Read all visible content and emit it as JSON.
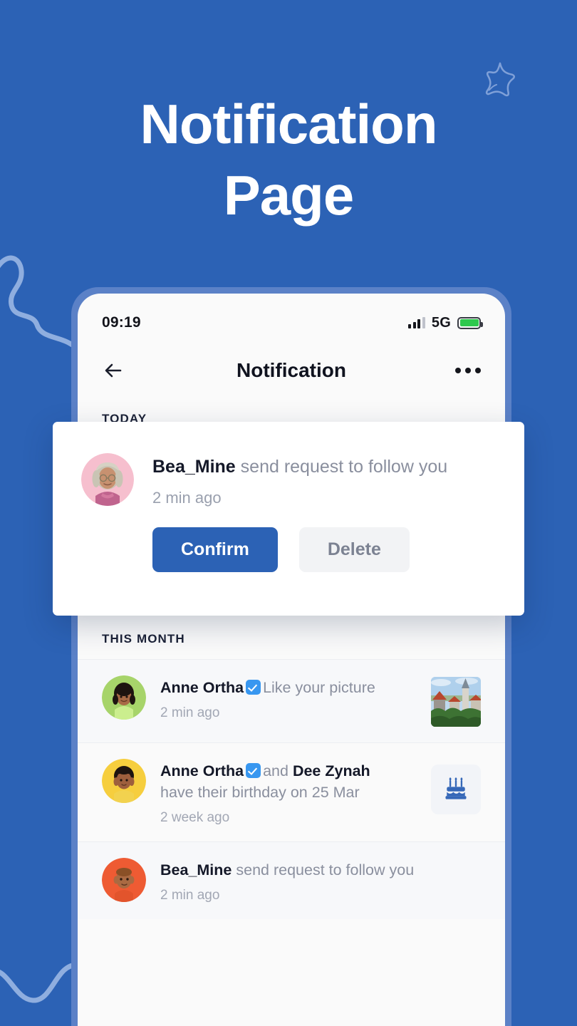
{
  "theme": {
    "background": "#2C62B5",
    "phone_frame": "#5B81C7",
    "screen": "#FAFAFA",
    "accent": "#2C62B5",
    "verified_badge": "#3897F0",
    "battery_green": "#2DC84D"
  },
  "hero": {
    "line1": "Notification",
    "line2": "Page",
    "star_icon": "star-outline-icon"
  },
  "status_bar": {
    "time": "09:19",
    "network": "5G",
    "signal_icon": "signal-bars-icon",
    "battery_icon": "battery-full-icon"
  },
  "nav": {
    "back_icon": "arrow-left-icon",
    "title": "Notification",
    "more_icon": "more-horizontal-icon"
  },
  "sections": {
    "today": "TODAY",
    "this_month": "THIS MONTH"
  },
  "buttons": {
    "confirm": "Confirm",
    "delete": "Delete"
  },
  "overlay_card": {
    "avatar_icon": "avatar-pink-grayhair",
    "user": "Bea_Mine",
    "message": "send request to follow you",
    "time": "2 min ago",
    "confirm_label": "Confirm",
    "delete_label": "Delete"
  },
  "notifications": [
    {
      "id": "covered-follow-request",
      "avatar_icon": "avatar-hidden",
      "user": "",
      "message": "",
      "time": "",
      "confirm_label": "Confirm",
      "delete_label": "Delete"
    },
    {
      "id": "like-your-picture",
      "avatar_icon": "avatar-green",
      "user": "Anne Ortha",
      "verified": true,
      "message": "Like your picture",
      "time": "2 min ago",
      "thumb_icon": "photo-thumbnail-cityscape"
    },
    {
      "id": "birthday",
      "avatar_icon": "avatar-yellow",
      "user": "Anne Ortha",
      "verified": true,
      "message": "and",
      "user2": "Dee Zynah",
      "submessage": "have their birthday on 25 Mar",
      "time": "2 week ago",
      "thumb_icon": "birthday-cake-icon"
    },
    {
      "id": "follow-request-bottom",
      "avatar_icon": "avatar-orange",
      "user": "Bea_Mine",
      "verified": false,
      "message": "send request to follow you",
      "time": "2 min ago"
    }
  ]
}
